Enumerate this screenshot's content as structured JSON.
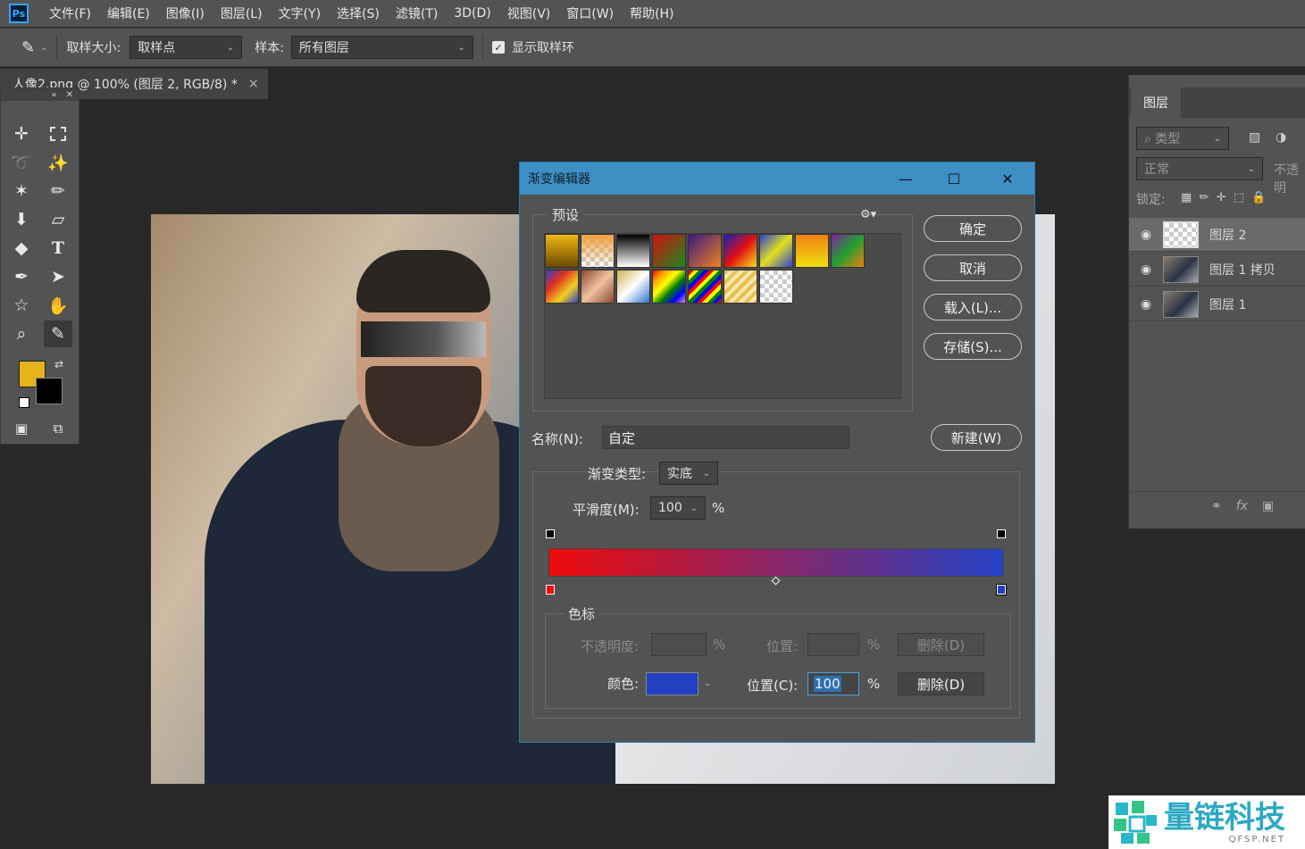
{
  "app": {
    "logo": "Ps"
  },
  "menu": [
    "文件(F)",
    "编辑(E)",
    "图像(I)",
    "图层(L)",
    "文字(Y)",
    "选择(S)",
    "滤镜(T)",
    "3D(D)",
    "视图(V)",
    "窗口(W)",
    "帮助(H)"
  ],
  "options": {
    "sample_size_label": "取样大小:",
    "sample_size_value": "取样点",
    "sample_label": "样本:",
    "sample_value": "所有图层",
    "show_ring_label": "显示取样环",
    "show_ring_checked": true
  },
  "doc_tab": {
    "title": "人像2.png @ 100% (图层 2, RGB/8) *",
    "close": "×"
  },
  "toolbar": {
    "icons": [
      "move-icon",
      "marquee-icon",
      "lasso-icon",
      "magic-wand-icon",
      "eyedropper-brush-icon",
      "brush-icon",
      "stamp-icon",
      "eraser-icon",
      "paint-bucket-icon",
      "type-icon",
      "pen-icon",
      "path-select-icon",
      "shape-icon",
      "hand-icon",
      "zoom-icon",
      "eyedropper-icon"
    ],
    "foreground_color": "#e8b21c",
    "background_color": "#000000"
  },
  "dialog": {
    "title": "渐变编辑器",
    "presets_label": "预设",
    "buttons": {
      "ok": "确定",
      "cancel": "取消",
      "load": "载入(L)...",
      "save": "存储(S)...",
      "new": "新建(W)"
    },
    "name_label": "名称(N):",
    "name_value": "自定",
    "gradient_type_label": "渐变类型:",
    "gradient_type_value": "实底",
    "smoothness_label": "平滑度(M):",
    "smoothness_value": "100",
    "percent": "%",
    "stops_label": "色标",
    "opacity_label": "不透明度:",
    "opacity_location_label": "位置:",
    "delete_label": "删除(D)",
    "color_label": "颜色:",
    "color_value": "#2340c0",
    "location_label": "位置(C):",
    "location_value": "100",
    "gradient_start": "#ee0a0a",
    "gradient_end": "#2442c4"
  },
  "layers": {
    "tab": "图层",
    "filter_label": "类型",
    "blend_mode": "正常",
    "opacity_label": "不透明",
    "lock_label": "锁定:",
    "items": [
      {
        "name": "图层 2",
        "visible": true,
        "selected": true
      },
      {
        "name": "图层 1 拷贝",
        "visible": true,
        "selected": false
      },
      {
        "name": "图层 1",
        "visible": true,
        "selected": false
      }
    ]
  },
  "watermark": {
    "cn": "量链科技",
    "en": "QFSP.NET"
  }
}
